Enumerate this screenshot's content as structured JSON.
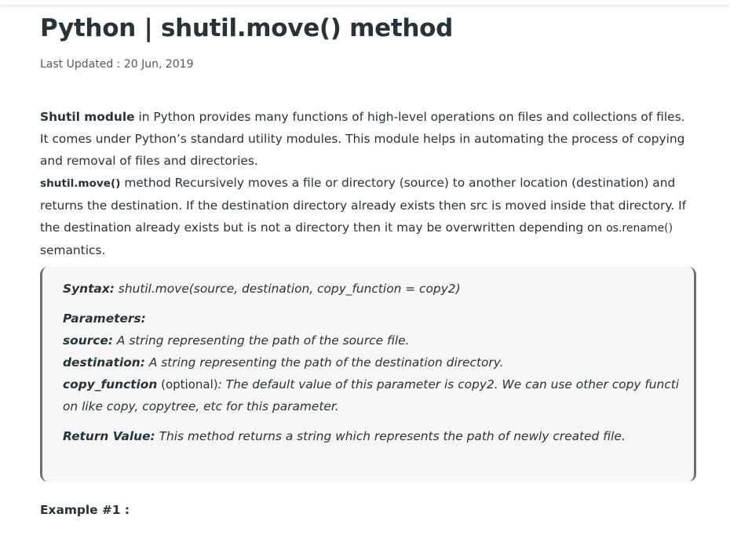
{
  "article": {
    "title": "Python | shutil.move() method",
    "last_updated": "Last Updated : 20 Jun, 2019",
    "intro": {
      "module_strong": "Shutil module",
      "module_text": " in Python provides many functions of high-level operations on files and collections of files. It comes under Python’s standard utility modules. This module helps in automating the process of copying and removal of files and directories.",
      "method_code": "shutil.move()",
      "method_text": " method Recursively moves a file or directory (source) to another location (destination) and returns the destination. If the destination directory already exists then src is moved inside that directory. If the destination already exists but is not a directory then it may be overwritten depending on ",
      "rename_code": "os.rename()",
      "rename_tail": " semantics."
    },
    "syntax_box": {
      "syntax_label": "Syntax:",
      "syntax_text": " shutil.move(source, destination, copy_function = copy2)",
      "parameters_label": "Parameters:",
      "source_label": "source:",
      "source_text": " A string representing the path of the source file.",
      "destination_label": "destination:",
      "destination_text": " A string representing the path of the destination directory.",
      "copy_function_label": "copy_function",
      "copy_function_optional": " (optional)",
      "copy_function_text": ": The default value of this parameter is copy2. We can use other copy functi on like copy, copytree, etc for this parameter.",
      "return_label": "Return Value:",
      "return_text": " This method returns a string which represents the path of newly created file."
    },
    "example_heading": "Example #1 :"
  }
}
